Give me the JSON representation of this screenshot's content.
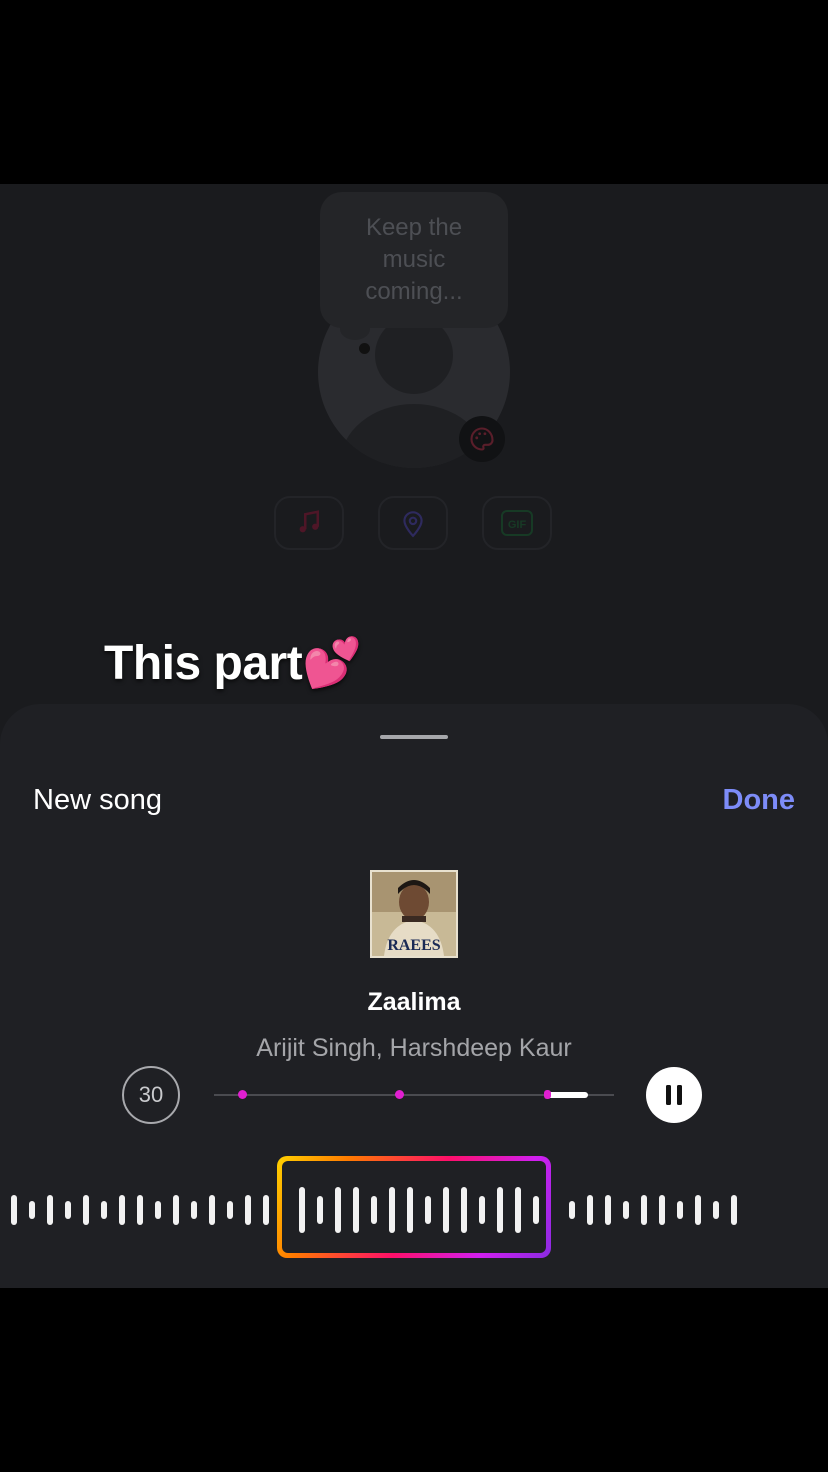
{
  "background": {
    "note_text": "Keep the music coming...",
    "icons": [
      "palette-icon",
      "music-note-icon",
      "location-pin-icon",
      "gif-icon"
    ]
  },
  "caption": {
    "text": "This part💕"
  },
  "sheet": {
    "title": "New song",
    "done_label": "Done",
    "song": {
      "title": "Zaalima",
      "artist": "Arijit Singh, Harshdeep Kaur",
      "cover_text": "RAEES"
    },
    "duration_label": "30",
    "playback": "playing"
  },
  "colors": {
    "accent_done": "#7d8cf8",
    "scrubber_pink": "#e01fd0",
    "gradient": [
      "#ffd200",
      "#ff7a00",
      "#ff0f6a",
      "#d11ff0",
      "#8a2be2"
    ]
  }
}
